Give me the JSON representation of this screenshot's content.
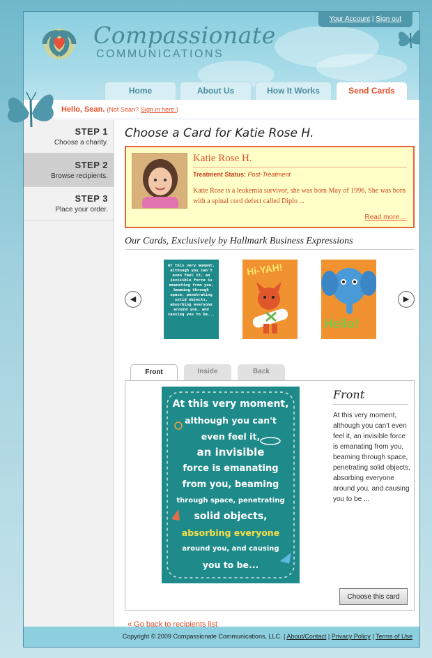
{
  "account": {
    "your_account": "Your Account",
    "separator": "|",
    "sign_out": "Sign out"
  },
  "logo": {
    "line1": "Compassionate",
    "line2": "COMMUNICATIONS"
  },
  "nav": [
    {
      "label": "Home"
    },
    {
      "label": "About Us"
    },
    {
      "label": "How It Works"
    },
    {
      "label": "Send Cards"
    }
  ],
  "greeting": {
    "hello": "Hello, Sean.",
    "not_you": "(Not Sean?",
    "sign_in": "Sign in here.",
    "close": ")"
  },
  "steps": [
    {
      "num": "STEP 1",
      "desc": "Choose a charity."
    },
    {
      "num": "STEP 2",
      "desc": "Browse recipients."
    },
    {
      "num": "STEP 3",
      "desc": "Place your order."
    }
  ],
  "page_title": "Choose a Card for Katie Rose H.",
  "recipient": {
    "name": "Katie Rose H.",
    "status_label": "Treatment Status:",
    "status_value": "Post-Treatment",
    "description": "Katie Rose is a leukemia survivor, she was born May of 1996. She was born with a spinal cord defect called Diplo ...",
    "read_more": "Read more ..."
  },
  "cards_heading": "Our Cards, Exclusively by Hallmark Business Expressions",
  "carousel": {
    "prev_icon": "◀",
    "next_icon": "▶",
    "thumbs": [
      {
        "text": "At this very moment, although you can't even feel it, an invisible force is emanating from you, beaming through space, penetrating solid objects, absorbing everyone around you, and causing you to be...",
        "bg": "#1f8a8a"
      },
      {
        "text": "Hi-YAH!",
        "bg": "#f0922f"
      },
      {
        "text": "Hello!",
        "bg": "#f0922f"
      }
    ]
  },
  "face_tabs": [
    {
      "label": "Front"
    },
    {
      "label": "Inside"
    },
    {
      "label": "Back"
    }
  ],
  "front_card": {
    "lines": [
      "At this very moment,",
      "although you can't",
      "even feel it,",
      "an invisible",
      "force is emanating",
      "from you, beaming",
      "through space, penetrating",
      "solid objects,",
      "absorbing everyone",
      "around you, and causing",
      "you to be..."
    ]
  },
  "front_title": "Front",
  "front_text": "At this very moment, although you can’t even feel it, an invisible force is emanating from you, beaming through space, penetrating solid objects, absorbing everyone around you, and causing you to be ...",
  "choose_button": "Choose this card",
  "back_link": "« Go back to recipients list",
  "footer": {
    "copyright": "Copyright © 2009 Compassionate Communications, LLC. |",
    "about": "About/Contact",
    "sep": "|",
    "privacy": "Privacy Policy",
    "terms": "Terms of Use"
  },
  "colors": {
    "accent": "#e3502c",
    "teal": "#4f97ab",
    "highlight_box": "#ffffc7"
  }
}
